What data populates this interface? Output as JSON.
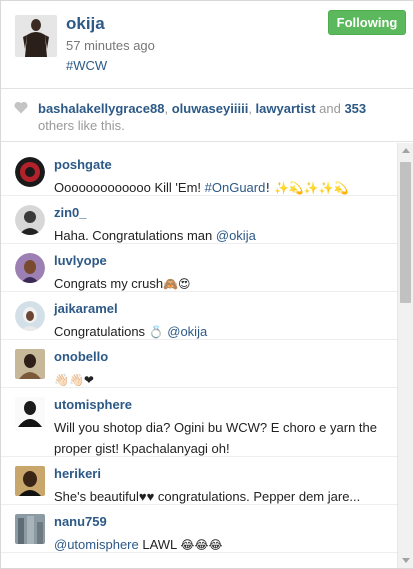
{
  "post": {
    "username": "okija",
    "time": "57 minutes ago",
    "hashtag": "#WCW",
    "follow_label": "Following"
  },
  "likes": {
    "user1": "bashalakellygrace88",
    "sep1": ", ",
    "user2": "oluwaseyiiiii",
    "sep2": ", ",
    "user3": "lawyartist",
    "rest_pre": " and ",
    "count": "353",
    "rest_post": " others like this."
  },
  "comments": [
    {
      "user": "poshgate",
      "text": "Ooooooooooooo Kill 'Em! ",
      "tag": "#OnGuard",
      "suffix": "! ✨💫✨✨💫"
    },
    {
      "user": "zin0_",
      "text": "Haha. Congratulations man ",
      "mention": "@okija"
    },
    {
      "user": "luvlyope",
      "text": "Congrats my crush",
      "suffix": "🙈😍"
    },
    {
      "user": "jaikaramel",
      "text": "Congratulations ",
      "ring": "💍",
      "mention": "@okija"
    },
    {
      "user": "onobello",
      "text": "👋🏻👋🏻❤"
    },
    {
      "user": "utomisphere",
      "text": "Will you shotop dia? Ogini bu WCW? E choro e yarn the proper gist! Kpachalanyagi oh!"
    },
    {
      "user": "herikeri",
      "text": "She's beautiful♥♥ congratulations. Pepper dem jare..."
    },
    {
      "user": "nanu759",
      "mention": "@utomisphere",
      "text": " LAWL ",
      "suffix": "😂😂😂"
    }
  ],
  "colors": {
    "link": "#2c5987",
    "follow_bg": "#5cb85c"
  }
}
